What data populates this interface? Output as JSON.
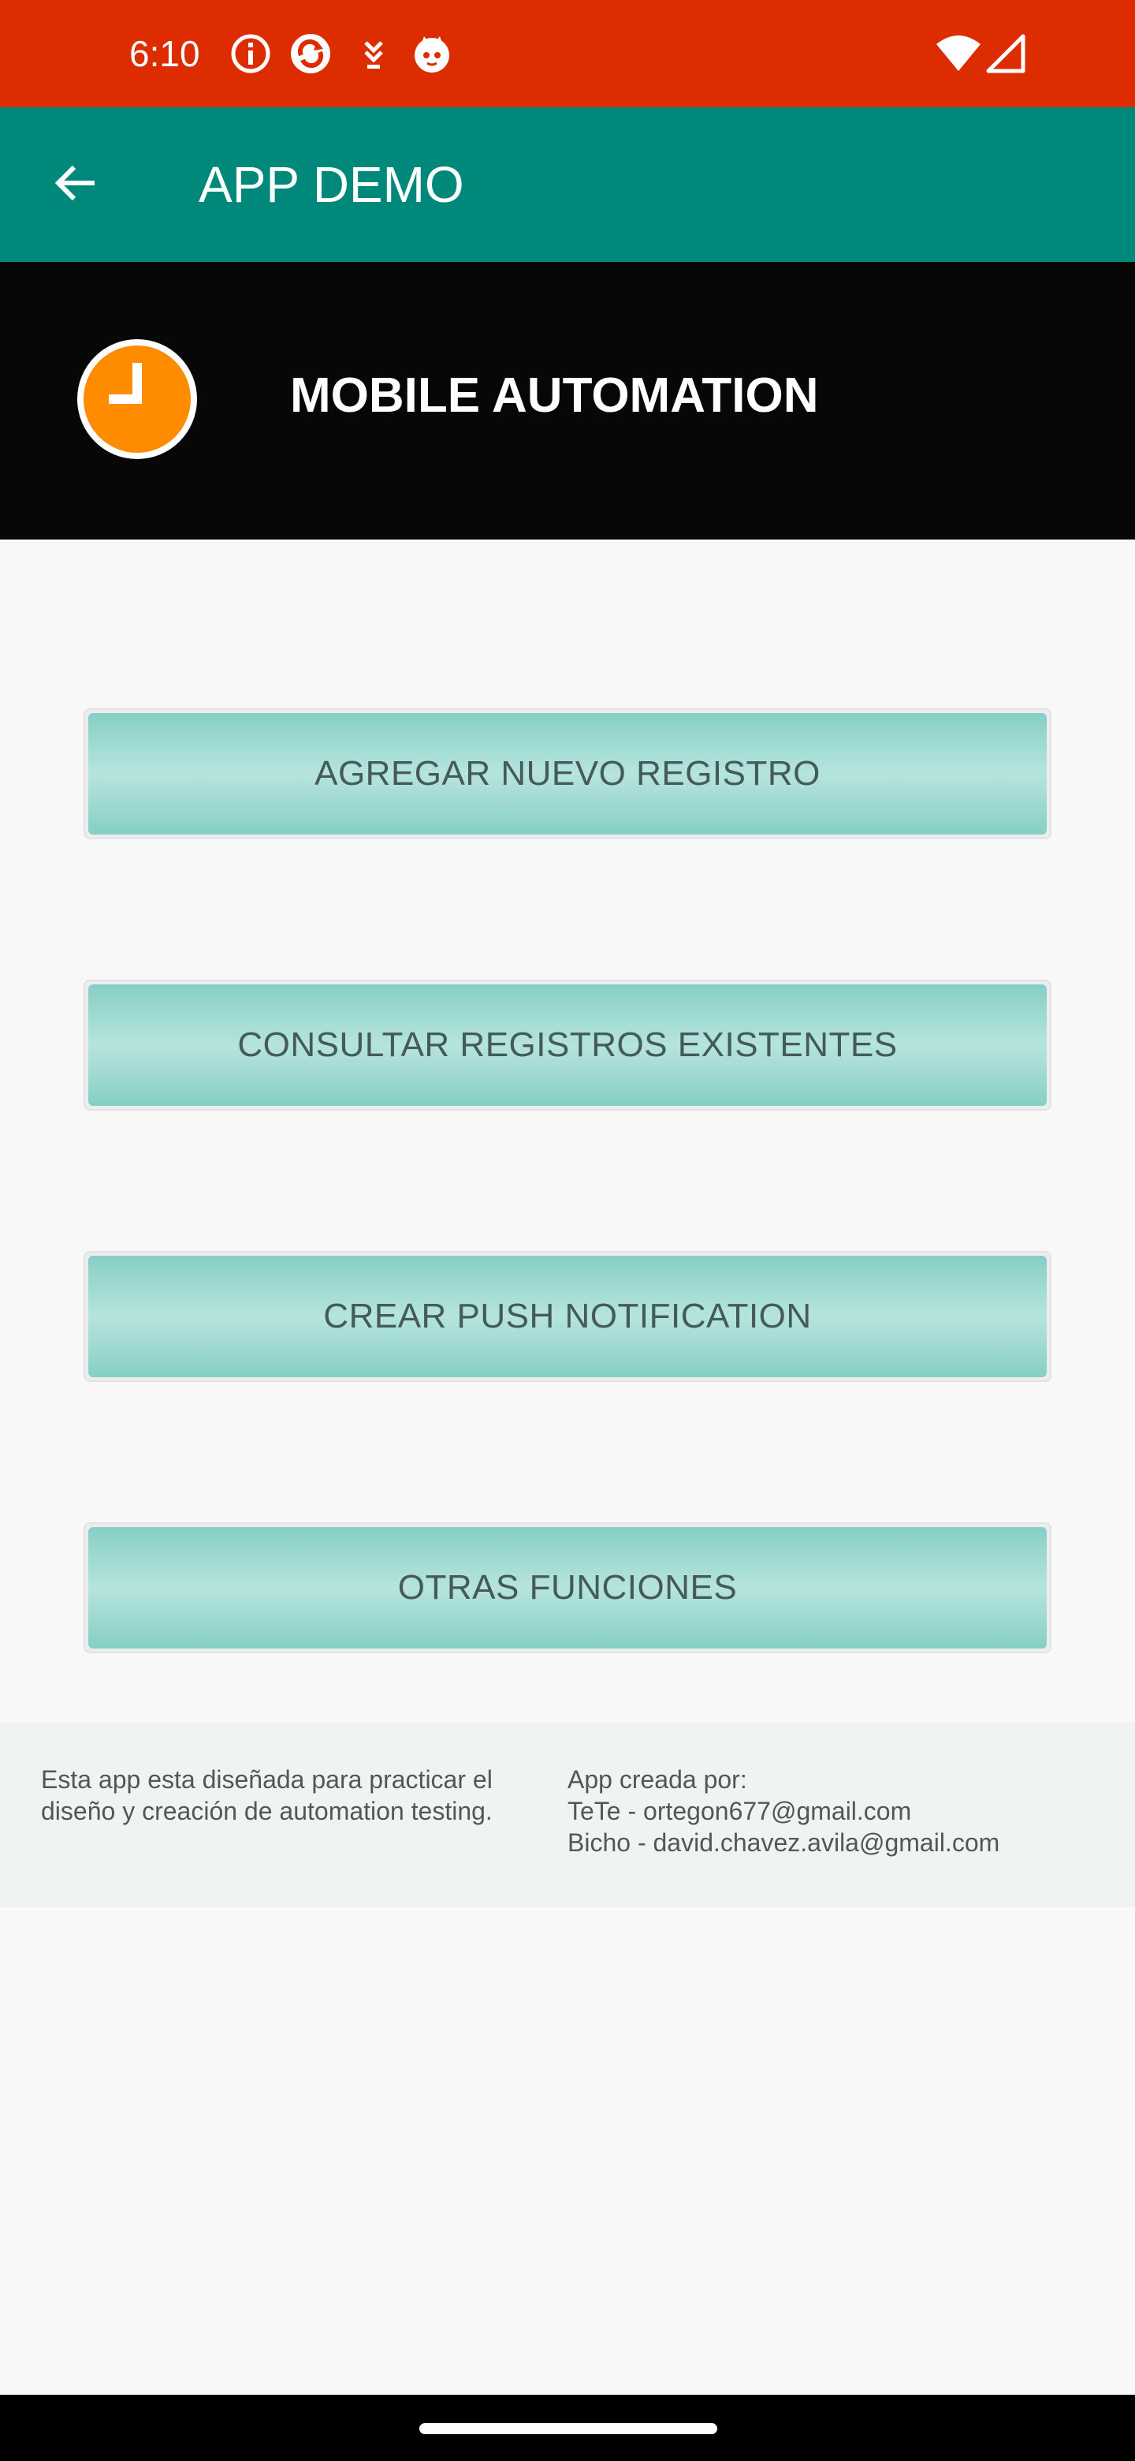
{
  "status_bar": {
    "time": "6:10",
    "background": "#dd2c00",
    "icons": [
      "info-icon",
      "sync-icon",
      "download-icon",
      "cat-app-icon"
    ],
    "system_icons": [
      "wifi-icon",
      "cell-signal-icon"
    ]
  },
  "app_bar": {
    "title": "APP DEMO",
    "background": "#00897b",
    "back_icon": "arrow-back-icon"
  },
  "header": {
    "title": "MOBILE AUTOMATION",
    "logo_icon": "clock-logo-icon",
    "logo_color": "#ff8c00"
  },
  "buttons": [
    {
      "label": "AGREGAR NUEVO REGISTRO"
    },
    {
      "label": "CONSULTAR REGISTROS EXISTENTES"
    },
    {
      "label": "CREAR PUSH NOTIFICATION"
    },
    {
      "label": "OTRAS FUNCIONES"
    }
  ],
  "footer": {
    "description": "Esta app esta diseñada para practicar el diseño y creación de automation testing.",
    "credits_title": "App creada por:",
    "credits": [
      "TeTe - ortegon677@gmail.com",
      "Bicho - david.chavez.avila@gmail.com"
    ]
  }
}
